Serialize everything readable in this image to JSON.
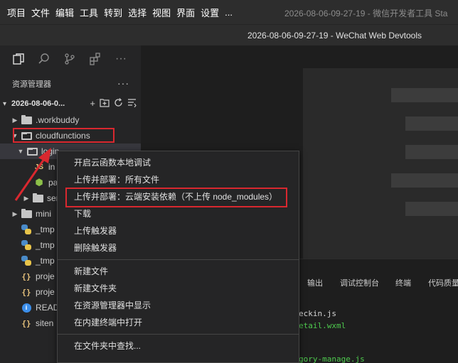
{
  "menubar": {
    "items": [
      "项目",
      "文件",
      "编辑",
      "工具",
      "转到",
      "选择",
      "视图",
      "界面",
      "设置",
      "..."
    ],
    "window_title": "2026-08-06-09-27-19 - 微信开发者工具 Sta"
  },
  "titlebar": {
    "title": "2026-08-06-09-27-19 - WeChat Web Devtools"
  },
  "activitybar": {
    "icons": [
      "files-icon",
      "search-icon",
      "source-control-icon",
      "extensions-icon",
      "more-icon"
    ],
    "more_label": "···"
  },
  "sidebar": {
    "header": "资源管理器",
    "more": "···",
    "project_name": "2026-08-06-0...",
    "tree": [
      {
        "label": ".workbuddy",
        "icon": "folder",
        "expanded": false
      },
      {
        "label": "cloudfunctions",
        "icon": "folder-open",
        "expanded": true
      },
      {
        "label": "login",
        "icon": "folder-open",
        "expanded": true
      },
      {
        "label": "in",
        "icon": "js"
      },
      {
        "label": "pa",
        "icon": "package"
      },
      {
        "label": "ser",
        "icon": "folder",
        "expanded": false
      },
      {
        "label": "mini",
        "icon": "folder",
        "expanded": false
      },
      {
        "label": "_tmp",
        "icon": "python"
      },
      {
        "label": "_tmp",
        "icon": "python"
      },
      {
        "label": "_tmp",
        "icon": "python"
      },
      {
        "label": "proje",
        "icon": "json"
      },
      {
        "label": "proje",
        "icon": "json"
      },
      {
        "label": "READ",
        "icon": "info"
      },
      {
        "label": "siten",
        "icon": "json"
      }
    ]
  },
  "context_menu": {
    "groups": [
      [
        "开启云函数本地调试",
        "上传并部署：所有文件",
        "上传并部署：云端安装依赖（不上传 node_modules）",
        "下载",
        "上传触发器",
        "删除触发器"
      ],
      [
        "新建文件",
        "新建文件夹",
        "在资源管理器中显示",
        "在内建终端中打开"
      ],
      [
        "在文件夹中查找..."
      ]
    ]
  },
  "panel": {
    "tabs": [
      "输出",
      "调试控制台",
      "终端",
      "代码质量"
    ],
    "lines": [
      "eckin.js",
      "etail.wxml",
      "gory-manage.js"
    ]
  },
  "colors": {
    "highlight_box": "#d9282f",
    "arrow": "#d9282f"
  }
}
